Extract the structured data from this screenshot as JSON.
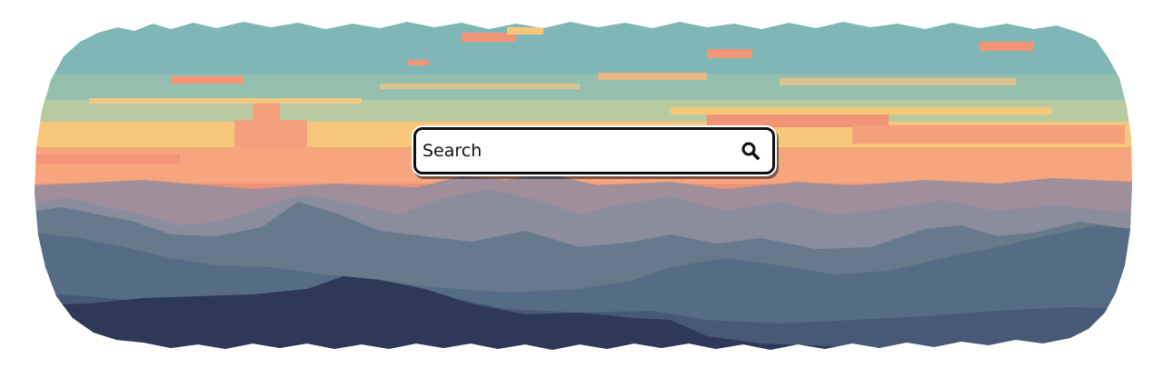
{
  "search": {
    "placeholder": "Search",
    "value": "",
    "button_icon": "magnifier-icon"
  },
  "colors": {
    "sky_teal": "#7fb7b6",
    "sky_mint": "#a9c6a6",
    "sky_yellow": "#f6c77a",
    "sky_peach": "#f59a76",
    "cloud_salmon": "#f29478",
    "ridge_far": "#a08f9a",
    "ridge_mid": "#8b8d9d",
    "ridge_slate": "#667a8c",
    "ridge_blue": "#546d84",
    "ridge_near": "#465a75",
    "ridge_dark": "#2e3857",
    "search_border": "#111111",
    "search_bg": "#ffffff"
  }
}
